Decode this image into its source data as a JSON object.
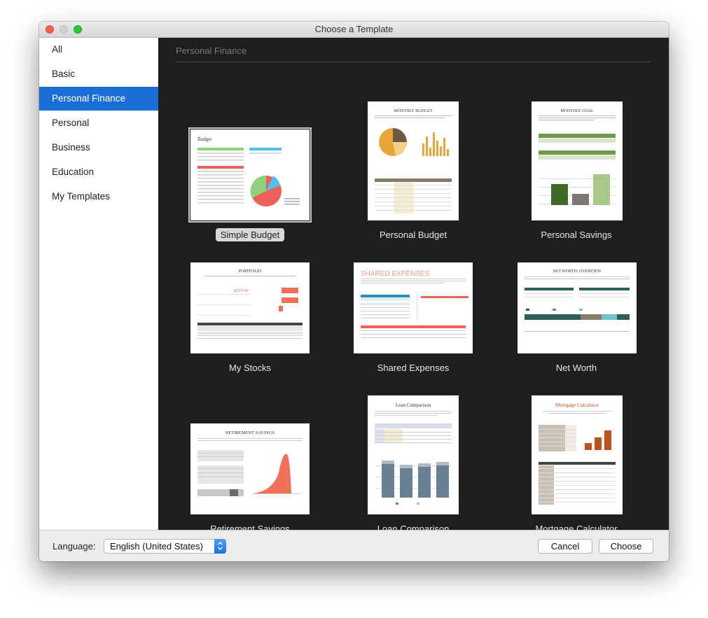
{
  "window": {
    "title": "Choose a Template"
  },
  "sidebar": {
    "items": [
      {
        "label": "All"
      },
      {
        "label": "Basic"
      },
      {
        "label": "Personal Finance",
        "selected": true
      },
      {
        "label": "Personal"
      },
      {
        "label": "Business"
      },
      {
        "label": "Education"
      },
      {
        "label": "My Templates"
      }
    ]
  },
  "main": {
    "section_title": "Personal Finance",
    "templates": [
      {
        "name": "Simple Budget",
        "selected": true,
        "thumb": {
          "heading": "Budget"
        }
      },
      {
        "name": "Personal Budget",
        "thumb": {
          "heading": "MONTHLY BUDGET"
        }
      },
      {
        "name": "Personal Savings",
        "thumb": {
          "heading": "MONTHLY GOAL"
        }
      },
      {
        "name": "My Stocks",
        "thumb": {
          "heading": "PORTFOLIO",
          "value": "$7274.40"
        }
      },
      {
        "name": "Shared Expenses",
        "thumb": {
          "heading": "SHARED EXPENSES"
        }
      },
      {
        "name": "Net Worth",
        "thumb": {
          "heading": "NET WORTH: OVERVIEW"
        }
      },
      {
        "name": "Retirement Savings",
        "thumb": {
          "heading": "RETIREMENT SAVINGS"
        }
      },
      {
        "name": "Loan Comparison",
        "thumb": {
          "heading": "Loan Comparison"
        }
      },
      {
        "name": "Mortgage Calculator",
        "thumb": {
          "heading": "Mortgage Calculator"
        }
      }
    ]
  },
  "footer": {
    "language_label": "Language:",
    "language_value": "English (United States)",
    "cancel_label": "Cancel",
    "choose_label": "Choose"
  },
  "colors": {
    "accent": "#1a6fd4",
    "content_bg": "#1e1e1e",
    "close": "#fc5f57",
    "zoom": "#2ac83f"
  }
}
